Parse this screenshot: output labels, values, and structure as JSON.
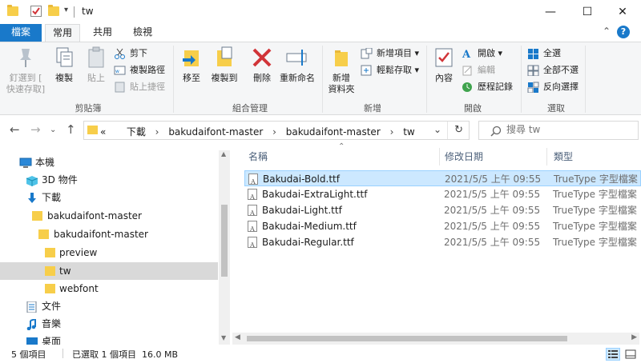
{
  "window": {
    "title": "tw",
    "controls": {
      "minimize": "—",
      "maximize": "☐",
      "close": "✕"
    }
  },
  "ribbon_tabs": [
    "檔案",
    "常用",
    "共用",
    "檢視"
  ],
  "ribbon": {
    "clipboard": {
      "pin": "釘選到 [\n快速存取]",
      "pin_line1": "釘選到 [",
      "pin_line2": "快速存取]",
      "copy": "複製",
      "paste": "貼上",
      "cut": "剪下",
      "copy_path": "複製路徑",
      "paste_shortcut": "貼上捷徑",
      "label": "剪貼簿"
    },
    "organize": {
      "move_to": "移至",
      "copy_to": "複製到",
      "delete": "刪除",
      "rename": "重新命名",
      "label": "組合管理"
    },
    "new": {
      "new_folder_line1": "新增",
      "new_folder_line2": "資料夾",
      "new_item": "新增項目",
      "easy_access": "輕鬆存取",
      "label": "新增"
    },
    "open": {
      "properties": "內容",
      "open": "開啟",
      "edit": "編輯",
      "history": "歷程記錄",
      "label": "開啟"
    },
    "select": {
      "select_all": "全選",
      "select_none": "全部不選",
      "invert": "反向選擇",
      "label": "選取"
    }
  },
  "address": {
    "crumbs": [
      "下載",
      "bakudaifont-master",
      "bakudaifont-master",
      "tw"
    ],
    "prefix": "«"
  },
  "search": {
    "placeholder": "搜尋 tw"
  },
  "nav_tree": [
    {
      "label": "本機",
      "icon": "computer-icon",
      "indent": 0
    },
    {
      "label": "3D 物件",
      "icon": "3d-objects-icon",
      "indent": 1
    },
    {
      "label": "下載",
      "icon": "download-icon",
      "indent": 1
    },
    {
      "label": "bakudaifont-master",
      "icon": "folder-icon",
      "indent": 2
    },
    {
      "label": "bakudaifont-master",
      "icon": "folder-icon",
      "indent": 3
    },
    {
      "label": "preview",
      "icon": "folder-icon",
      "indent": 4
    },
    {
      "label": "tw",
      "icon": "folder-icon",
      "indent": 4,
      "selected": true
    },
    {
      "label": "webfont",
      "icon": "folder-icon",
      "indent": 4
    },
    {
      "label": "文件",
      "icon": "documents-icon",
      "indent": 1
    },
    {
      "label": "音樂",
      "icon": "music-icon",
      "indent": 1
    },
    {
      "label": "桌面",
      "icon": "desktop-icon",
      "indent": 1
    }
  ],
  "columns": {
    "name": "名稱",
    "date": "修改日期",
    "type": "類型"
  },
  "files": [
    {
      "name": "Bakudai-Bold.ttf",
      "date": "2021/5/5 上午 09:55",
      "type": "TrueType 字型檔案",
      "selected": true
    },
    {
      "name": "Bakudai-ExtraLight.ttf",
      "date": "2021/5/5 上午 09:55",
      "type": "TrueType 字型檔案"
    },
    {
      "name": "Bakudai-Light.ttf",
      "date": "2021/5/5 上午 09:55",
      "type": "TrueType 字型檔案"
    },
    {
      "name": "Bakudai-Medium.ttf",
      "date": "2021/5/5 上午 09:55",
      "type": "TrueType 字型檔案"
    },
    {
      "name": "Bakudai-Regular.ttf",
      "date": "2021/5/5 上午 09:55",
      "type": "TrueType 字型檔案"
    }
  ],
  "status": {
    "count": "5 個項目",
    "selection": "已選取 1 個項目  16.0 MB"
  },
  "colors": {
    "accent": "#1979ca",
    "selected_row": "#cce8ff",
    "folder": "#f7ce4a"
  }
}
